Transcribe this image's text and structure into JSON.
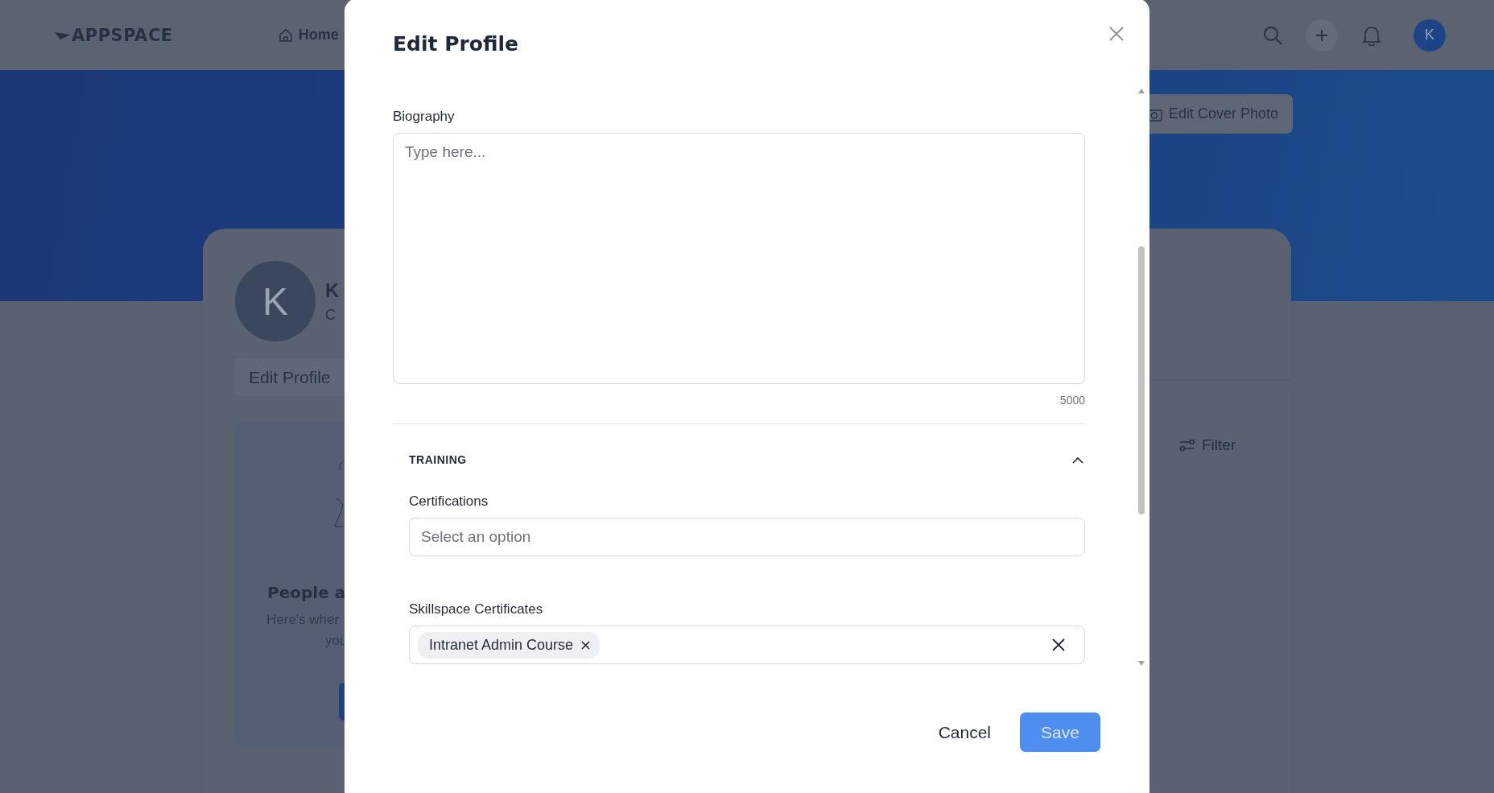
{
  "header": {
    "logo": "APPSPACE",
    "nav": [
      {
        "label": "Home"
      }
    ],
    "avatar": "K"
  },
  "cover": {
    "edit_button": "Edit Cover Photo"
  },
  "profile": {
    "avatar": "K",
    "name": "K",
    "subtitle": "C",
    "edit_button": "Edit Profile",
    "card_title": "People a",
    "card_lines": [
      "Here's wher",
      "you"
    ]
  },
  "filter": {
    "label": "Filter"
  },
  "modal": {
    "title": "Edit Profile",
    "fields": [
      {
        "kind": "textarea",
        "label": "Biography",
        "placeholder": "Type here...",
        "counter": "5000"
      }
    ],
    "sections": [
      {
        "title": "TRAINING",
        "expanded": true,
        "fields": [
          {
            "kind": "select",
            "label": "Certifications",
            "placeholder": "Select an option"
          },
          {
            "kind": "tags",
            "label": "Skillspace Certificates",
            "tags": [
              "Intranet Admin Course"
            ]
          }
        ]
      }
    ],
    "cancel": "Cancel",
    "save": {
      "label": "Save",
      "disabled": true
    }
  }
}
